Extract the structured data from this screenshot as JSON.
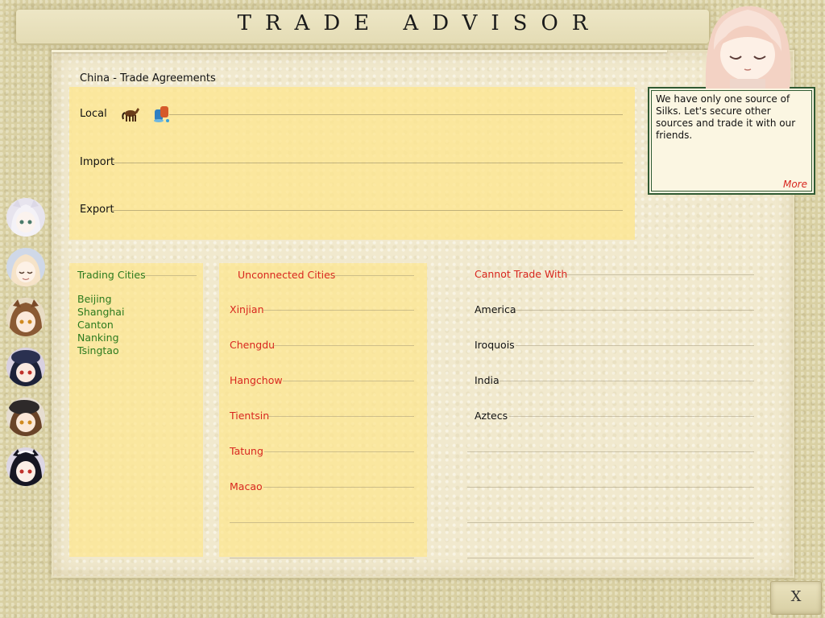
{
  "title": "TRADE ADVISOR",
  "agreements": {
    "title": "China - Trade Agreements",
    "rows": [
      {
        "label": "Local",
        "resources": [
          "horses-icon",
          "silks-icon"
        ]
      },
      {
        "label": "Import",
        "resources": []
      },
      {
        "label": "Export",
        "resources": []
      }
    ]
  },
  "trading": {
    "header": "Trading Cities",
    "cities": [
      "Beijing",
      "Shanghai",
      "Canton",
      "Nanking",
      "Tsingtao"
    ]
  },
  "unconnected": {
    "header": "Unconnected Cities",
    "cities": [
      "Xinjian",
      "Chengdu",
      "Hangchow",
      "Tientsin",
      "Tatung",
      "Macao"
    ]
  },
  "cannot_trade": {
    "header": "Cannot Trade With",
    "civs": [
      "America",
      "Iroquois",
      "India",
      "Aztecs"
    ]
  },
  "advisor": {
    "message": "We have only one source of Silks. Let's secure other sources and trade it with our friends.",
    "more_label": "More"
  },
  "exit": {
    "glyph": "X"
  },
  "colors": {
    "trading": "#2b7a1e",
    "unconnected": "#d8261e",
    "box_yellow": "#fde68c",
    "advisor_border": "#2f5a33"
  }
}
